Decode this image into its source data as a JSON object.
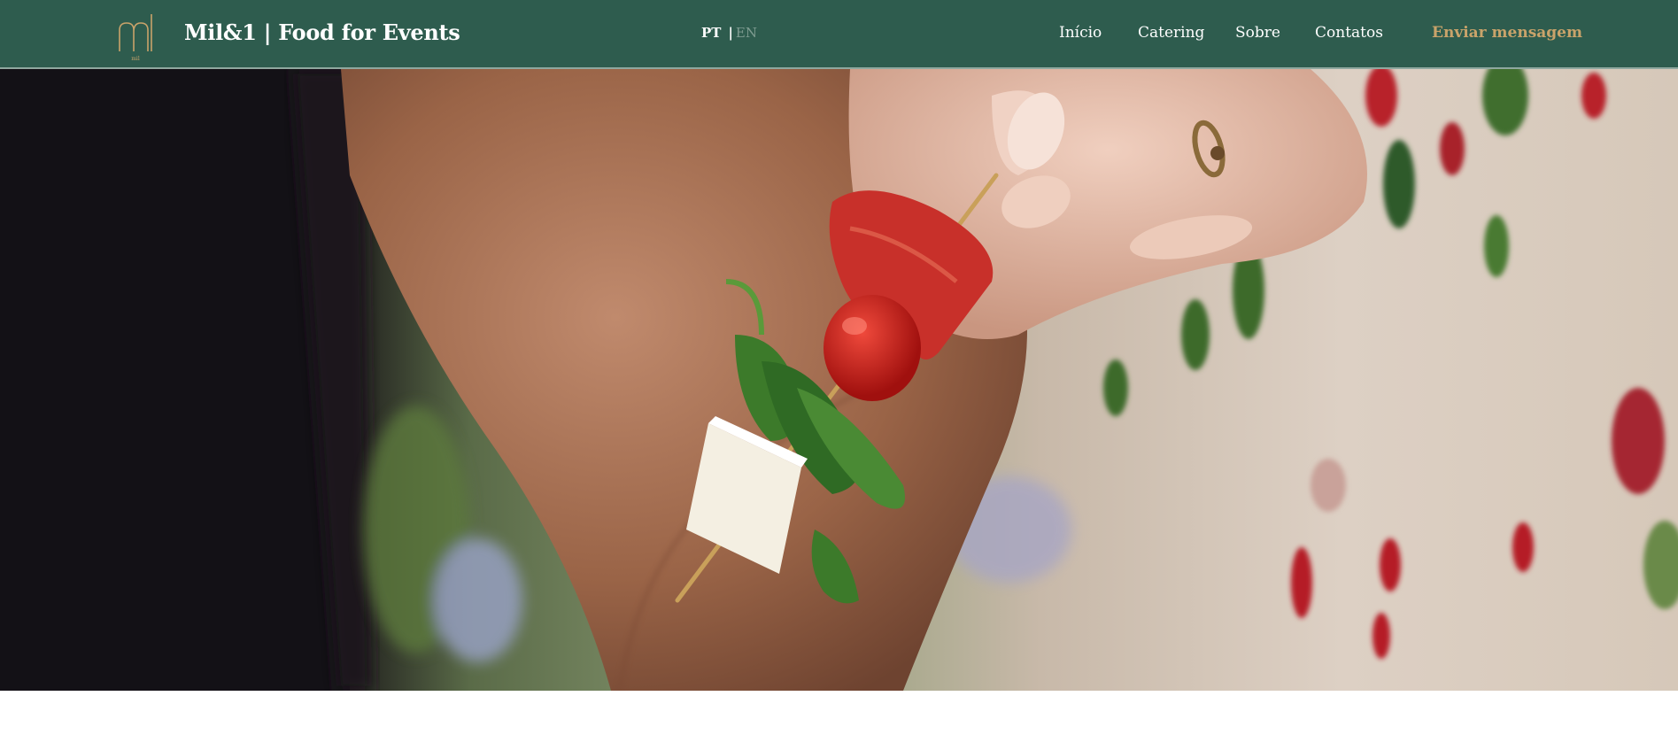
{
  "header": {
    "brand": "Mil&1 | Food for Events",
    "logo_icon": "m-monogram-logo-icon",
    "background_color": "#2e5c4e",
    "accent_color": "#c9a36a"
  },
  "language": {
    "current": "PT",
    "separator": "|",
    "other": "EN"
  },
  "nav": {
    "items": [
      {
        "label": "Início"
      },
      {
        "label": "Catering"
      },
      {
        "label": "Sobre"
      },
      {
        "label": "Contatos"
      }
    ],
    "cta_label": "Enviar mensagem"
  },
  "hero": {
    "slide_count": 4,
    "active_slide": 3
  }
}
